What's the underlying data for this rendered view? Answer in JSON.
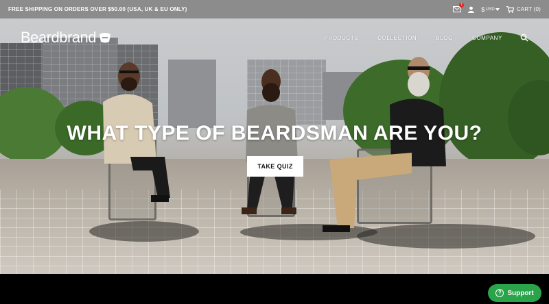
{
  "topbar": {
    "shipping_text": "FREE SHIPPING ON ORDERS OVER $50.00 (USA, UK & EU ONLY)",
    "mail_badge": "1",
    "currency_symbol": "$",
    "currency_code": "USD",
    "cart_label": "CART (0)"
  },
  "nav": {
    "logo_text": "Beardbrand",
    "items": [
      "PRODUCTS",
      "COLLECTION",
      "BLOG",
      "COMPANY"
    ]
  },
  "hero": {
    "headline": "WHAT TYPE OF BEARDSMAN ARE YOU?",
    "cta_label": "TAKE QUIZ"
  },
  "support": {
    "label": "Support",
    "icon_text": "?"
  },
  "colors": {
    "topbar_bg": "#8c8c8c",
    "support_green": "#2aa34a"
  }
}
